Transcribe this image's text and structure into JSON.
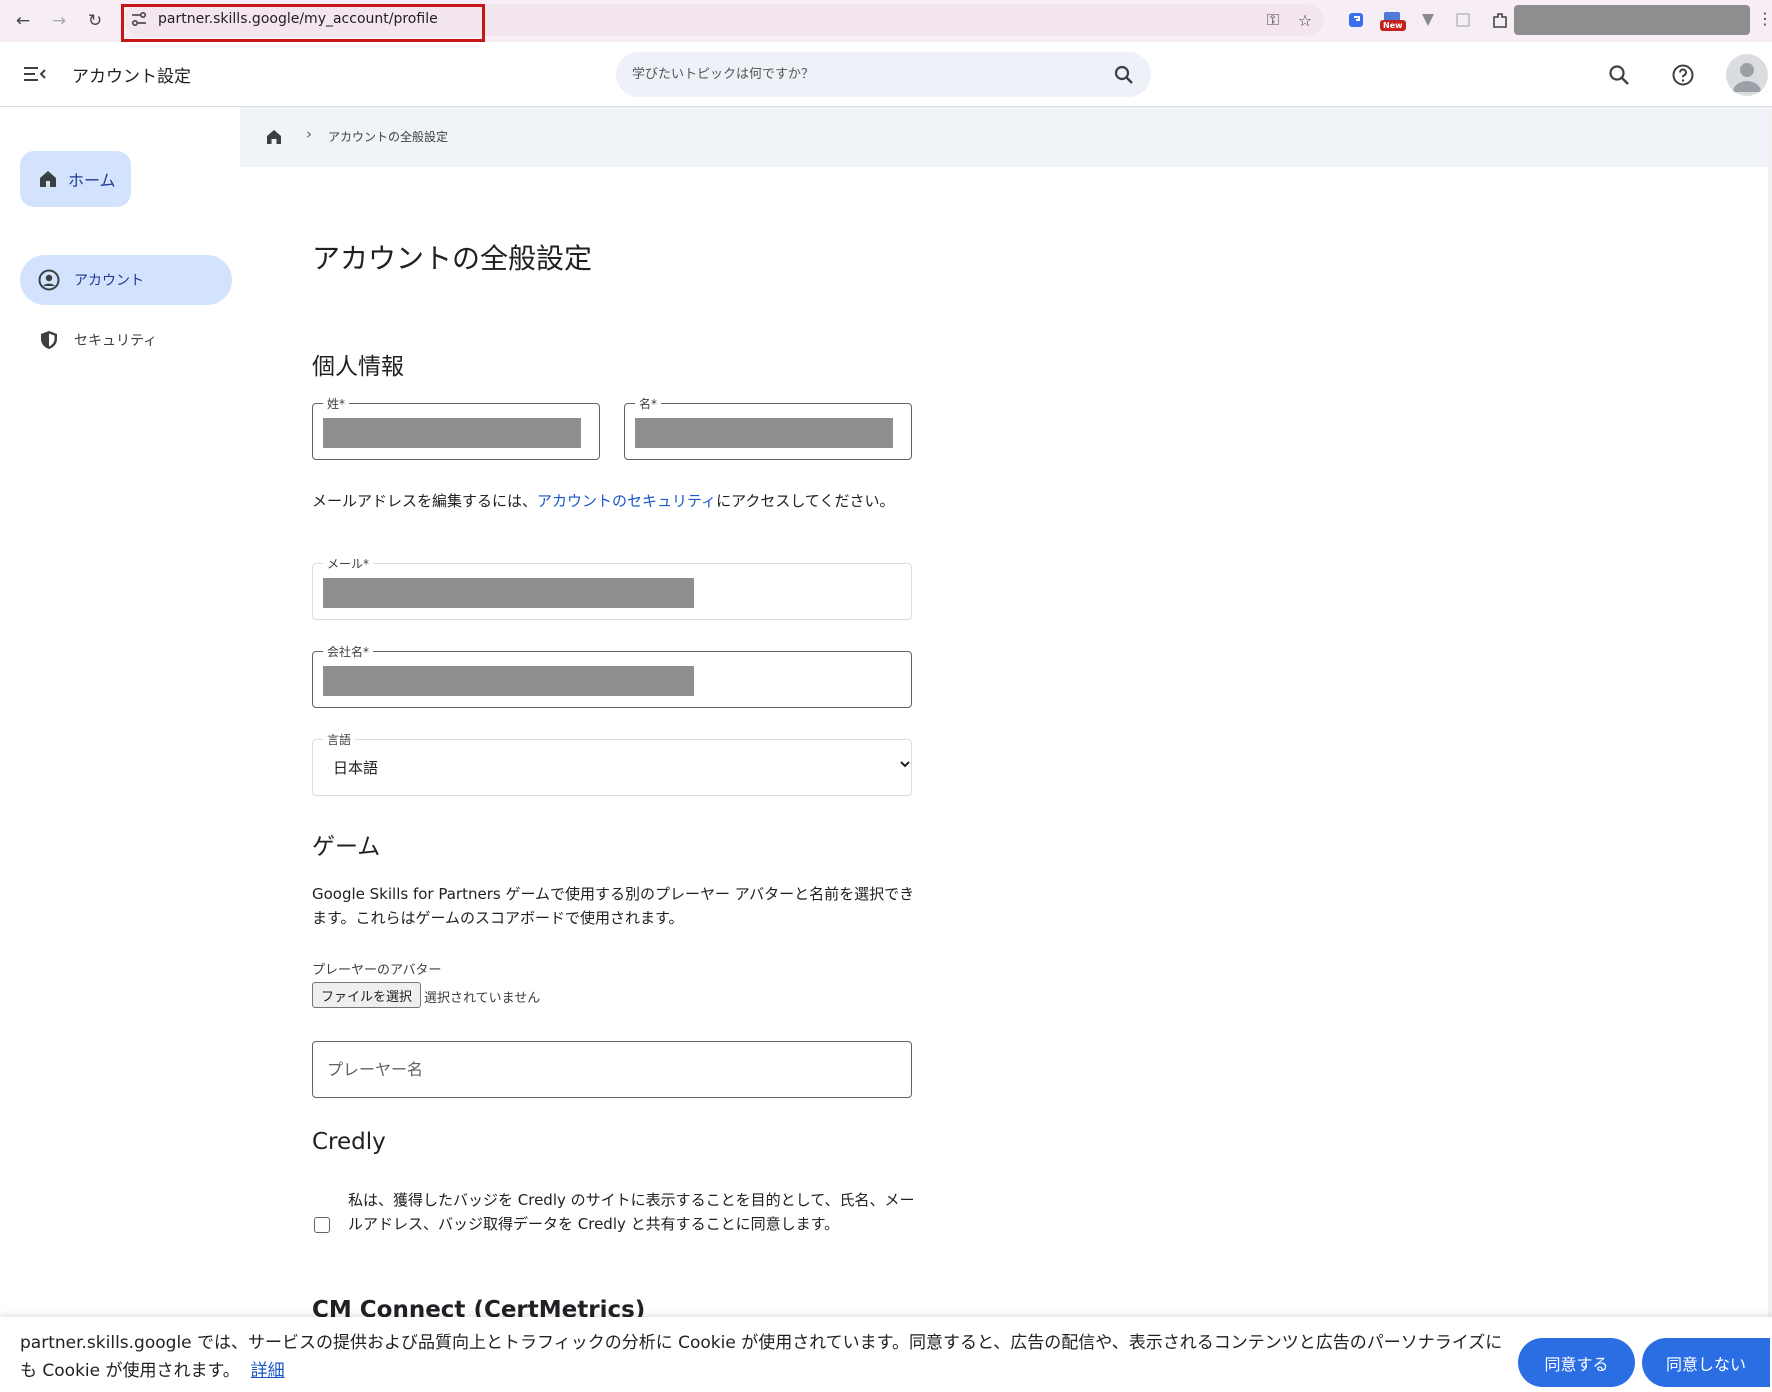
{
  "browser": {
    "url": "partner.skills.google/my_account/profile",
    "new_badge": "New"
  },
  "header": {
    "title": "アカウント設定",
    "search_placeholder": "学びたいトピックは何ですか？"
  },
  "sidebar": {
    "home_label": "ホーム",
    "items": [
      {
        "label": "アカウント",
        "icon": "account-circle-icon",
        "active": true
      },
      {
        "label": "セキュリティ",
        "icon": "shield-icon",
        "active": false
      }
    ]
  },
  "breadcrumb": {
    "current": "アカウントの全般設定"
  },
  "page": {
    "title": "アカウントの全般設定"
  },
  "personal": {
    "heading": "個人情報",
    "last_name_label": "姓*",
    "first_name_label": "名*",
    "email_note_before": "メールアドレスを編集するには、",
    "email_note_link": "アカウントのセキュリティ",
    "email_note_after": "にアクセスしてください。",
    "email_label": "メール*",
    "company_label": "会社名*",
    "language_label": "言語",
    "language_value": "日本語"
  },
  "game": {
    "heading": "ゲーム",
    "description": "Google Skills for Partners ゲームで使用する別のプレーヤー アバターと名前を選択できます。これらはゲームのスコアボードで使用されます。",
    "avatar_label": "プレーヤーのアバター",
    "file_button": "ファイルを選択",
    "file_status": "選択されていません",
    "player_name_placeholder": "プレーヤー名"
  },
  "credly": {
    "heading": "Credly",
    "consent": "私は、獲得したバッジを Credly のサイトに表示することを目的として、氏名、メールアドレス、バッジ取得データを Credly と共有することに同意します。"
  },
  "cm_connect": {
    "heading": "CM Connect (CertMetrics)"
  },
  "cookie": {
    "text": "partner.skills.google では、サービスの提供および品質向上とトラフィックの分析に Cookie が使用されています。同意すると、広告の配信や、表示されるコンテンツと広告のパーソナライズにも Cookie が使用されます。",
    "link": "詳細",
    "accept": "同意する",
    "decline": "同意しない"
  },
  "colors": {
    "accent": "#1a57c8",
    "active_nav": "#d3e3fd",
    "button": "#2b6ee3",
    "redaction": "#8e8e8e"
  }
}
